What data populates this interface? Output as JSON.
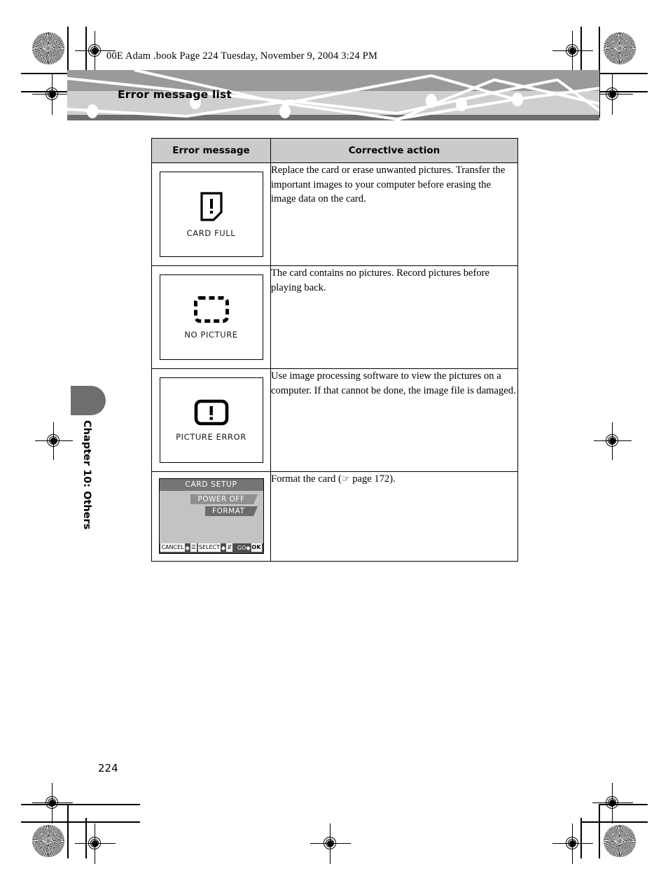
{
  "running_head": "00E Adam .book  Page 224  Tuesday, November 9, 2004  3:24 PM",
  "banner": {
    "title": "Error message list"
  },
  "chapter_tab": {
    "label": "Chapter 10: Others"
  },
  "folio": {
    "page_number": "224"
  },
  "table": {
    "headers": [
      "Error message",
      "Corrective action"
    ],
    "rows": [
      {
        "icon_name": "card-full-icon",
        "screen_label": "CARD FULL",
        "action": "Replace the card or erase unwanted pictures. Transfer the important images to your computer before erasing the image data on the card."
      },
      {
        "icon_name": "no-picture-icon",
        "screen_label": "NO PICTURE",
        "action": "The card contains no pictures. Record pictures before playing back."
      },
      {
        "icon_name": "picture-error-icon",
        "screen_label": "PICTURE ERROR",
        "action": "Use image processing software to view the pictures on a computer. If that cannot be done, the image file is damaged."
      },
      {
        "icon_name": "card-setup-screen",
        "screen": {
          "title": "CARD SETUP",
          "options": [
            "POWER OFF",
            "FORMAT"
          ],
          "selected_option": "FORMAT",
          "statusbar": {
            "cancel_label": "CANCEL",
            "select_label": "SELECT",
            "go_label": "GO",
            "ok_label": "OK"
          }
        },
        "action_prefix": "Format the card  (",
        "action_icon": "pointing-hand-icon",
        "action_suffix": " page 172)."
      }
    ]
  },
  "colors": {
    "banner_top": "#9a9a9a",
    "banner_bottom": "#cfcfcf",
    "banner_footbar": "#6e6e6e",
    "table_header_fill": "#cbcbcb",
    "lcd_body": "#c3c3c3",
    "lcd_title": "#757575",
    "lcd_option": "#8f8f8f",
    "lcd_option_selected": "#6b6b6b",
    "lcd_statusbar": "#4d4d4d"
  }
}
